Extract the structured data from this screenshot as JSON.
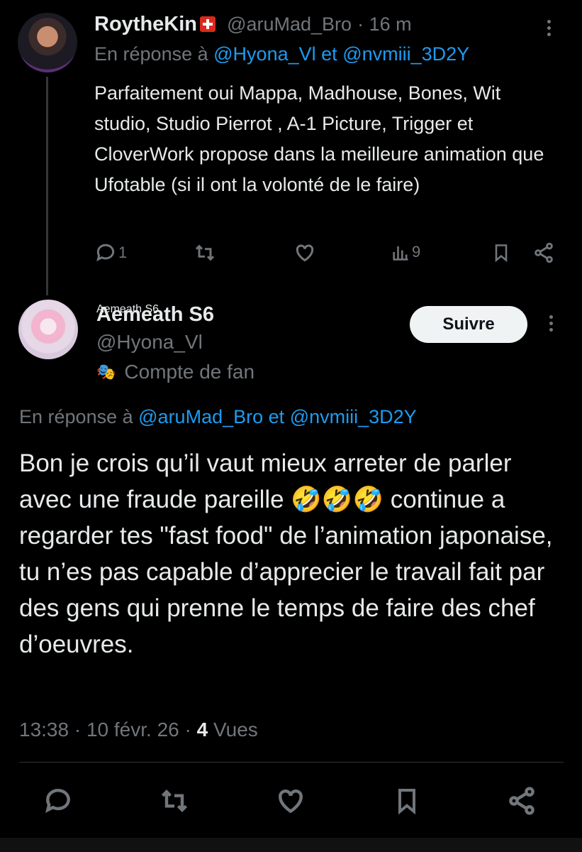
{
  "reply_tweet": {
    "display_name": "RoytheKin",
    "handle": "@aruMad_Bro",
    "time": "· 16 m",
    "in_reply_prefix": "En réponse à",
    "in_reply_user1": "@Hyona_Vl",
    "in_reply_and": "et",
    "in_reply_user2": "@nvmiii_3D2Y",
    "body": "Parfaitement oui Mappa, Madhouse, Bones, Wit studio, Studio Pierrot , A-1 Picture, Trigger et CloverWork propose dans la meilleure animation que Ufotable (si il ont la volonté de le faire)",
    "reply_count": "1",
    "views_count": "9"
  },
  "main_tweet": {
    "display_name": "Aemeath S6",
    "handle": "@Hyona_Vl",
    "account_label": "Compte de fan",
    "follow_label": "Suivre",
    "in_reply_prefix": "En réponse à",
    "in_reply_user1": "@aruMad_Bro",
    "in_reply_and": "et",
    "in_reply_user2": "@nvmiii_3D2Y",
    "body": "Bon je crois qu’il vaut mieux arreter de parler avec une fraude pareille 🤣🤣🤣 continue a regarder tes \"fast food\" de l’animation japonaise, tu n’es pas capable d’apprecier le travail fait par des gens qui prenne le temps de faire des chef d’oeuvres.",
    "time": "13:38",
    "date": "10 févr. 26",
    "views_count": "4",
    "views_label": "Vues"
  },
  "icons": [
    "reply-icon",
    "retweet-icon",
    "like-icon",
    "views-icon",
    "bookmark-icon",
    "share-icon",
    "more-icon",
    "theater-mask-icon"
  ],
  "colors": {
    "background": "#000000",
    "text": "#e7e9ea",
    "muted": "#71767b",
    "link": "#1d9bf0",
    "follow_bg": "#eff3f4"
  }
}
